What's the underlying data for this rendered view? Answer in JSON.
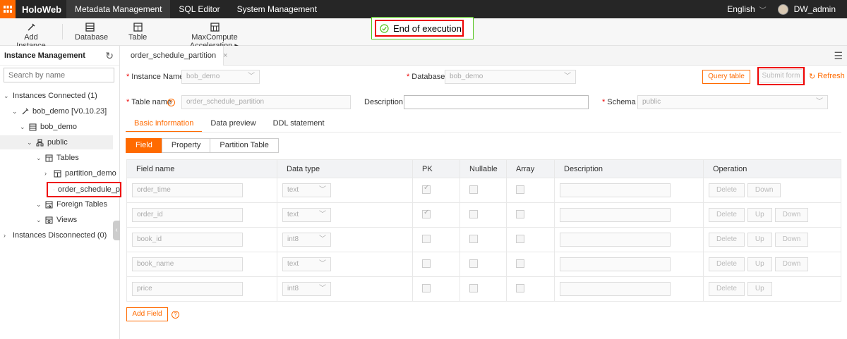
{
  "topnav": {
    "brand": "HoloWeb",
    "tabs": [
      "Metadata Management",
      "SQL Editor",
      "System Management"
    ],
    "language": "English",
    "user": "DW_admin"
  },
  "toolbar": {
    "add_instance": "Add Instance",
    "database": "Database",
    "table": "Table",
    "maxcompute": "MaxCompute Acceleration"
  },
  "toast": {
    "message": "End of execution"
  },
  "sidebar": {
    "title": "Instance Management",
    "search_placeholder": "Search by name",
    "connected": "Instances Connected (1)",
    "instance": "bob_demo [V0.10.23]",
    "database": "bob_demo",
    "schema": "public",
    "tables": "Tables",
    "table1": "partition_demo",
    "table2": "order_schedule_p",
    "foreign_tables": "Foreign Tables",
    "views": "Views",
    "disconnected": "Instances Disconnected (0)"
  },
  "tab": {
    "label": "order_schedule_partition"
  },
  "form": {
    "instance_label": "Instance Name",
    "instance_value": "bob_demo",
    "database_label": "Database",
    "database_value": "bob_demo",
    "query_table": "Query table",
    "submit_form": "Submit form",
    "refresh": "Refresh",
    "tablename_label": "Table name",
    "tablename_value": "order_schedule_partition",
    "description_label": "Description",
    "schema_label": "Schema",
    "schema_value": "public"
  },
  "subtabs": [
    "Basic information",
    "Data preview",
    "DDL statement"
  ],
  "segments": [
    "Field",
    "Property",
    "Partition Table"
  ],
  "grid": {
    "headers": [
      "Field name",
      "Data type",
      "PK",
      "Nullable",
      "Array",
      "Description",
      "Operation"
    ],
    "rows": [
      {
        "name": "order_time",
        "type": "text"
      },
      {
        "name": "order_id",
        "type": "text"
      },
      {
        "name": "book_id",
        "type": "int8"
      },
      {
        "name": "book_name",
        "type": "text"
      },
      {
        "name": "price",
        "type": "int8"
      }
    ],
    "btn_delete": "Delete",
    "btn_up": "Up",
    "btn_down": "Down"
  },
  "add_field": "Add Field",
  "colors": {
    "accent": "#ff6a00",
    "highlight": "#e00000",
    "toast_border": "#52c41a",
    "nav_bg": "#262626"
  }
}
